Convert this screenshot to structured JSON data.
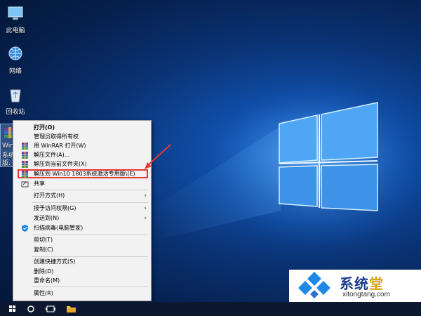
{
  "desktop": {
    "icons": [
      {
        "label": "此电脑",
        "icon": "computer-icon"
      },
      {
        "label": "网络",
        "icon": "network-icon"
      },
      {
        "label": "回收站",
        "icon": "recycle-bin-icon"
      }
    ],
    "selected_file": {
      "lines": [
        "Win10",
        "系统专",
        "版."
      ],
      "icon": "winrar-archive-icon"
    }
  },
  "context_menu": {
    "items": [
      {
        "label": "打开(O)",
        "bold": true
      },
      {
        "label": "管理员取得所有权"
      },
      {
        "label": "用 WinRAR 打开(W)",
        "icon": "winrar-icon"
      },
      {
        "label": "解压文件(A)...",
        "icon": "winrar-icon"
      },
      {
        "label": "解压到当前文件夹(X)",
        "icon": "winrar-icon"
      },
      {
        "label": "解压到 Win10 1803系统激活专用版\\(E)",
        "icon": "winrar-icon",
        "highlighted": true
      },
      {
        "label": "共享",
        "icon": "share-icon"
      },
      {
        "label": "打开方式(H)",
        "submenu": true
      },
      {
        "label": "授予访问权限(G)",
        "submenu": true
      },
      {
        "label": "发送到(N)",
        "submenu": true
      },
      {
        "label": "扫描病毒(电脑管家)",
        "icon": "shield-icon"
      },
      {
        "label": "剪切(T)"
      },
      {
        "label": "复制(C)"
      },
      {
        "label": "创建快捷方式(S)"
      },
      {
        "label": "删除(D)"
      },
      {
        "label": "重命名(M)"
      },
      {
        "label": "属性(R)"
      }
    ]
  },
  "watermark": {
    "title_main": "系统",
    "title_accent": "堂",
    "url": "xitongtang.com"
  },
  "taskbar": {
    "buttons": [
      "windows-start-icon",
      "cortana-circle-icon",
      "task-view-icon",
      "file-explorer-icon"
    ]
  },
  "colors": {
    "highlight_box": "#e53935",
    "menu_bg": "#f2f2f2",
    "taskbar_bg": "#0d1730",
    "logo_blue": "#1a3a8c",
    "logo_gold": "#d4a217"
  }
}
